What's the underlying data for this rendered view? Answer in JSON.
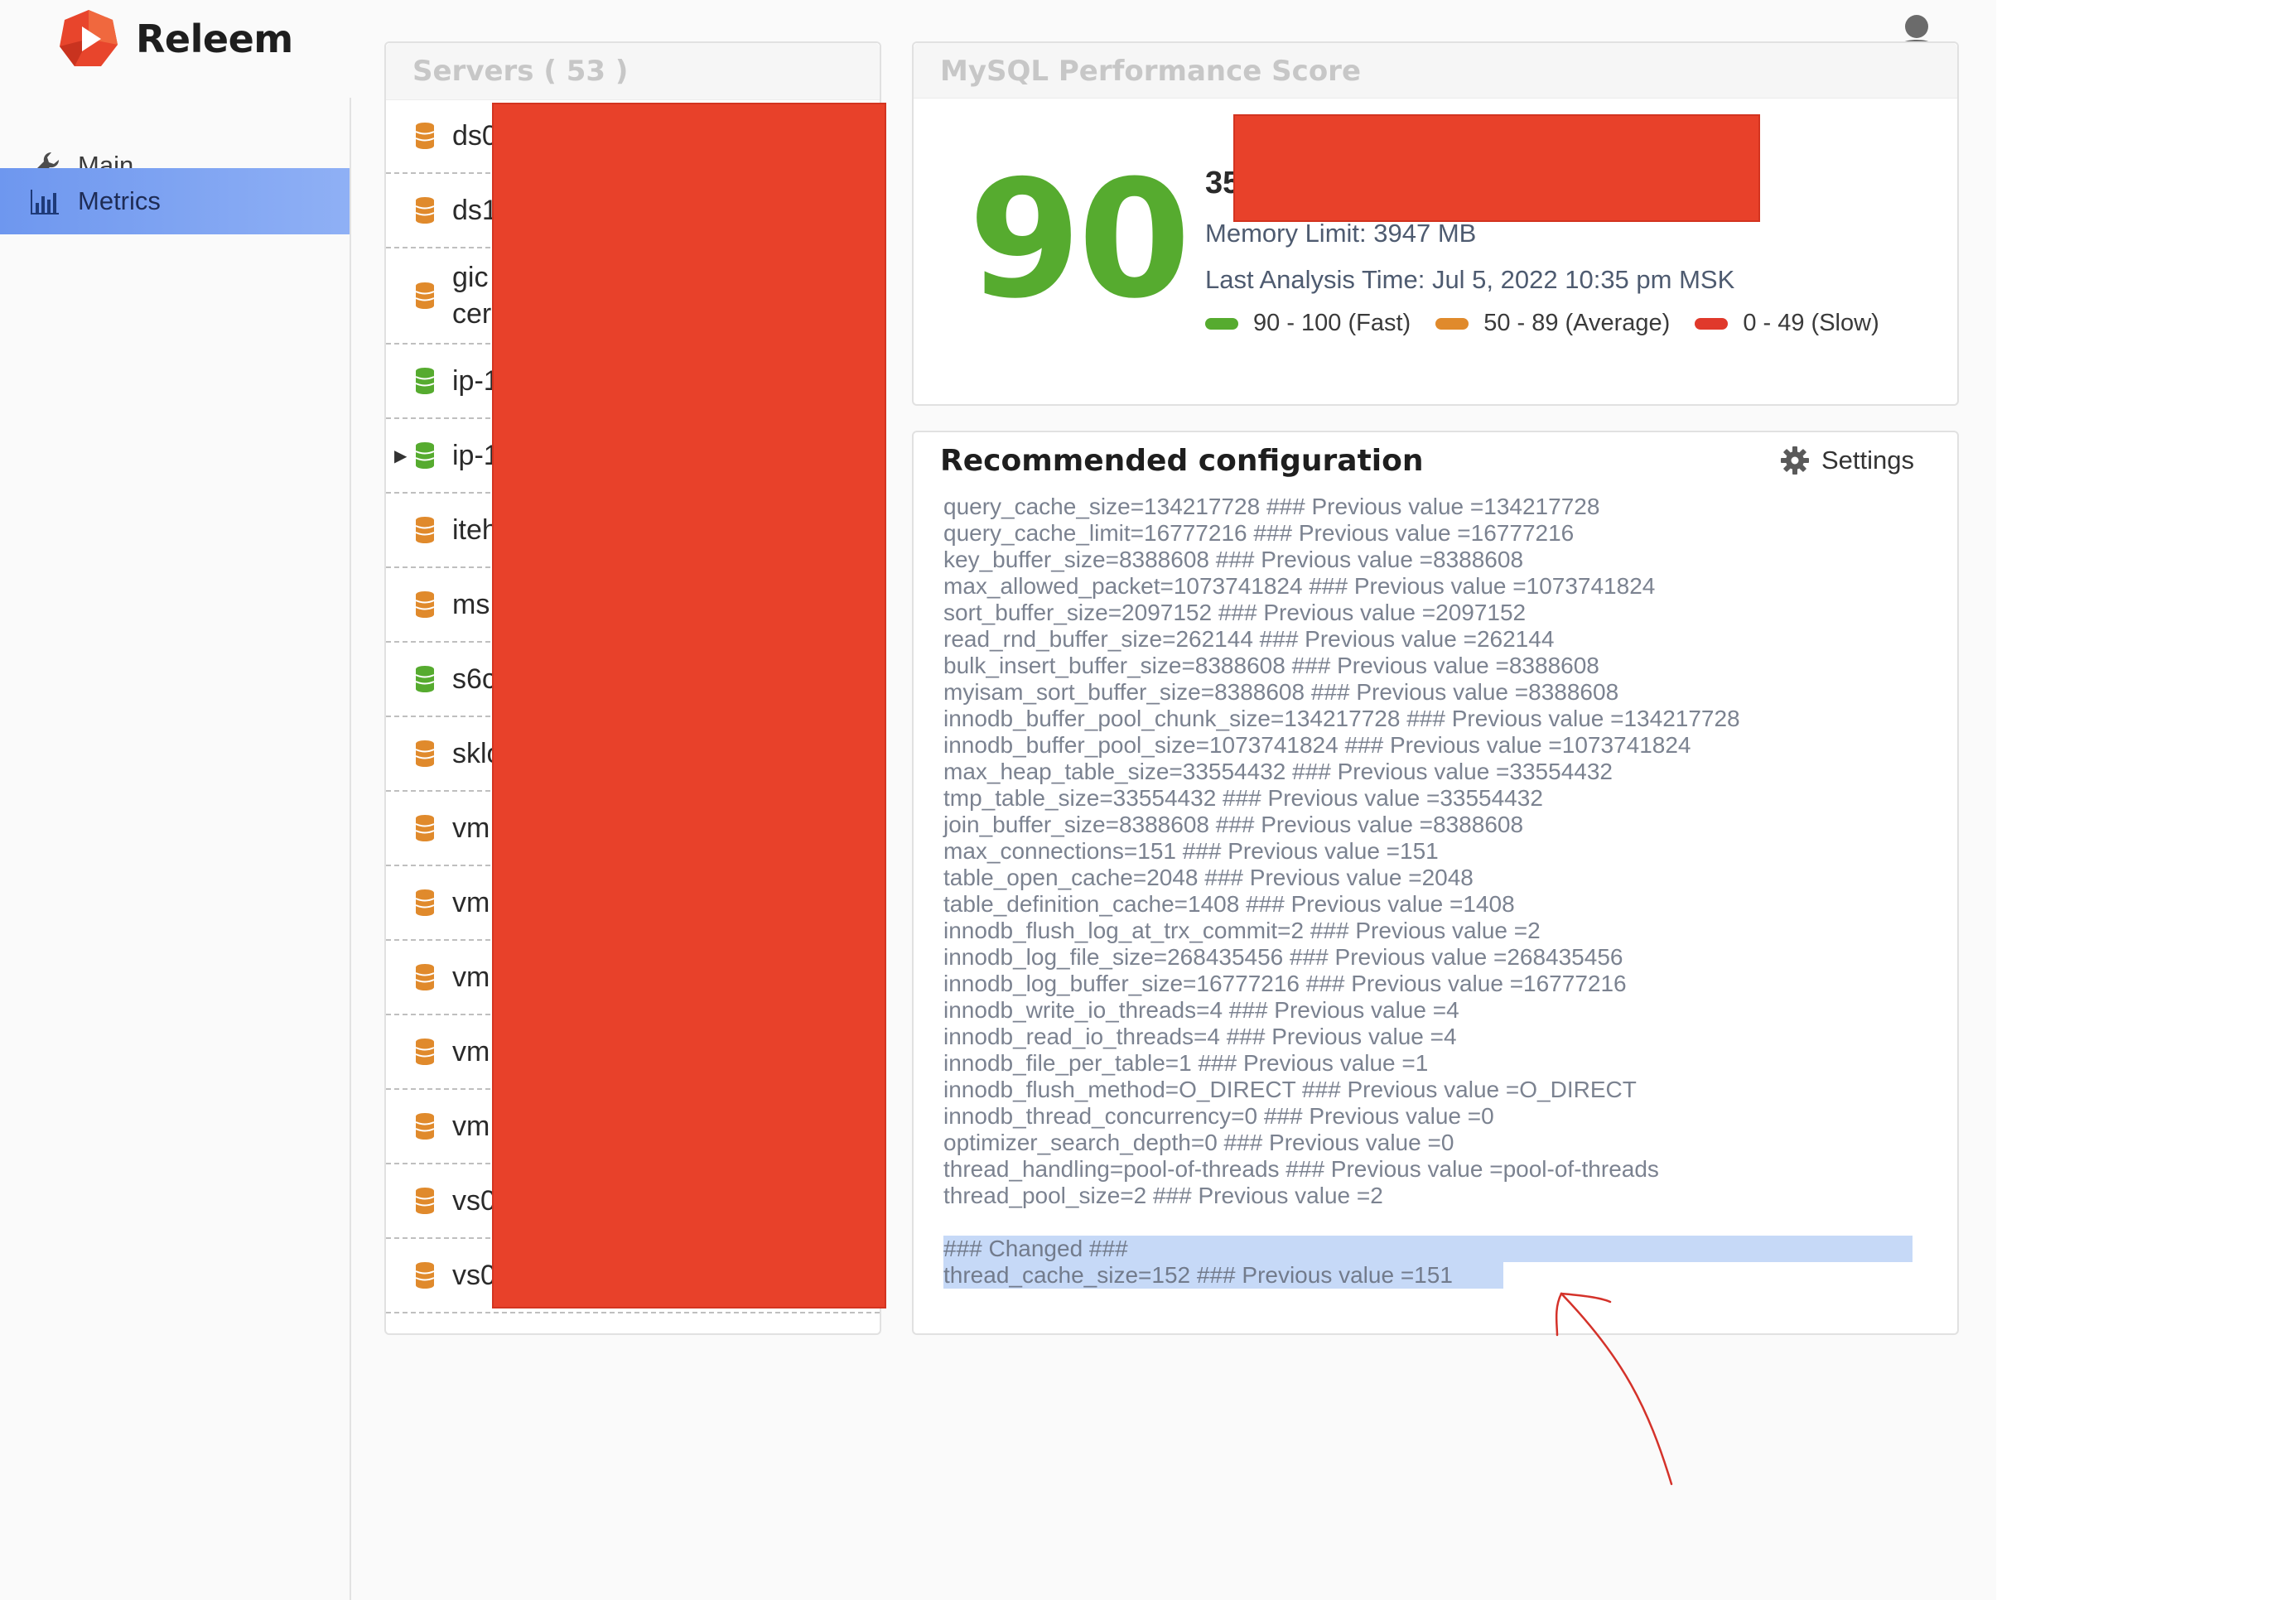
{
  "app": {
    "name": "Releem"
  },
  "colors": {
    "accent": "#6e97ef",
    "score_fast": "#56ab2f",
    "score_average": "#e08a2c",
    "score_slow": "#e0392b",
    "redaction": "#e8412a"
  },
  "sidebar": {
    "items": [
      {
        "label": "Main",
        "icon": "wrench-icon",
        "active": false
      },
      {
        "label": "Metrics",
        "icon": "bar-chart-icon",
        "active": true
      }
    ]
  },
  "servers": {
    "title": "Servers ( 53 )",
    "list": [
      {
        "name": "ds0",
        "status": "warning"
      },
      {
        "name": "ds1",
        "status": "warning"
      },
      {
        "name": "gic\ncer",
        "status": "warning"
      },
      {
        "name": "ip-1",
        "status": "ok"
      },
      {
        "name": "ip-1",
        "status": "ok",
        "selected": true
      },
      {
        "name": "iteh",
        "status": "warning"
      },
      {
        "name": "ms",
        "status": "warning"
      },
      {
        "name": "s6c",
        "status": "ok"
      },
      {
        "name": "sklo",
        "status": "warning"
      },
      {
        "name": "vm",
        "status": "warning"
      },
      {
        "name": "vm",
        "status": "warning"
      },
      {
        "name": "vm",
        "status": "warning"
      },
      {
        "name": "vm",
        "status": "warning"
      },
      {
        "name": "vm",
        "status": "warning"
      },
      {
        "name": "vs0",
        "status": "warning"
      },
      {
        "name": "vs0",
        "status": "warning"
      }
    ]
  },
  "score": {
    "title": "MySQL Performance Score",
    "value": "90",
    "server_prefix": "35",
    "memory_limit": "Memory Limit: 3947 MB",
    "last_analysis": "Last Analysis Time: Jul 5, 2022 10:35 pm MSK",
    "legend": [
      {
        "label": "90 - 100 (Fast)",
        "color": "#56ab2f"
      },
      {
        "label": "50 - 89 (Average)",
        "color": "#e08a2c"
      },
      {
        "label": "0 - 49 (Slow)",
        "color": "#e0392b"
      }
    ]
  },
  "config": {
    "title": "Recommended configuration",
    "settings_label": "Settings",
    "lines": [
      "query_cache_size=134217728 ### Previous value =134217728",
      "query_cache_limit=16777216 ### Previous value =16777216",
      "key_buffer_size=8388608 ### Previous value =8388608",
      "max_allowed_packet=1073741824 ### Previous value =1073741824",
      "sort_buffer_size=2097152 ### Previous value =2097152",
      "read_rnd_buffer_size=262144 ### Previous value =262144",
      "bulk_insert_buffer_size=8388608 ### Previous value =8388608",
      "myisam_sort_buffer_size=8388608 ### Previous value =8388608",
      "innodb_buffer_pool_chunk_size=134217728 ### Previous value =134217728",
      "innodb_buffer_pool_size=1073741824 ### Previous value =1073741824",
      "max_heap_table_size=33554432 ### Previous value =33554432",
      "tmp_table_size=33554432 ### Previous value =33554432",
      "join_buffer_size=8388608 ### Previous value =8388608",
      "max_connections=151 ### Previous value =151",
      "table_open_cache=2048 ### Previous value =2048",
      "table_definition_cache=1408 ### Previous value =1408",
      "innodb_flush_log_at_trx_commit=2 ### Previous value =2",
      "innodb_log_file_size=268435456 ### Previous value =268435456",
      "innodb_log_buffer_size=16777216 ### Previous value =16777216",
      "innodb_write_io_threads=4 ### Previous value =4",
      "innodb_read_io_threads=4 ### Previous value =4",
      "innodb_file_per_table=1 ### Previous value =1",
      "innodb_flush_method=O_DIRECT ### Previous value =O_DIRECT",
      "innodb_thread_concurrency=0 ### Previous value =0",
      "optimizer_search_depth=0 ### Previous value =0",
      "thread_handling=pool-of-threads ### Previous value =pool-of-threads",
      "thread_pool_size=2 ### Previous value =2"
    ],
    "changed_header": "### Changed ###",
    "changed_lines": [
      "thread_cache_size=152 ### Previous value =151"
    ]
  }
}
